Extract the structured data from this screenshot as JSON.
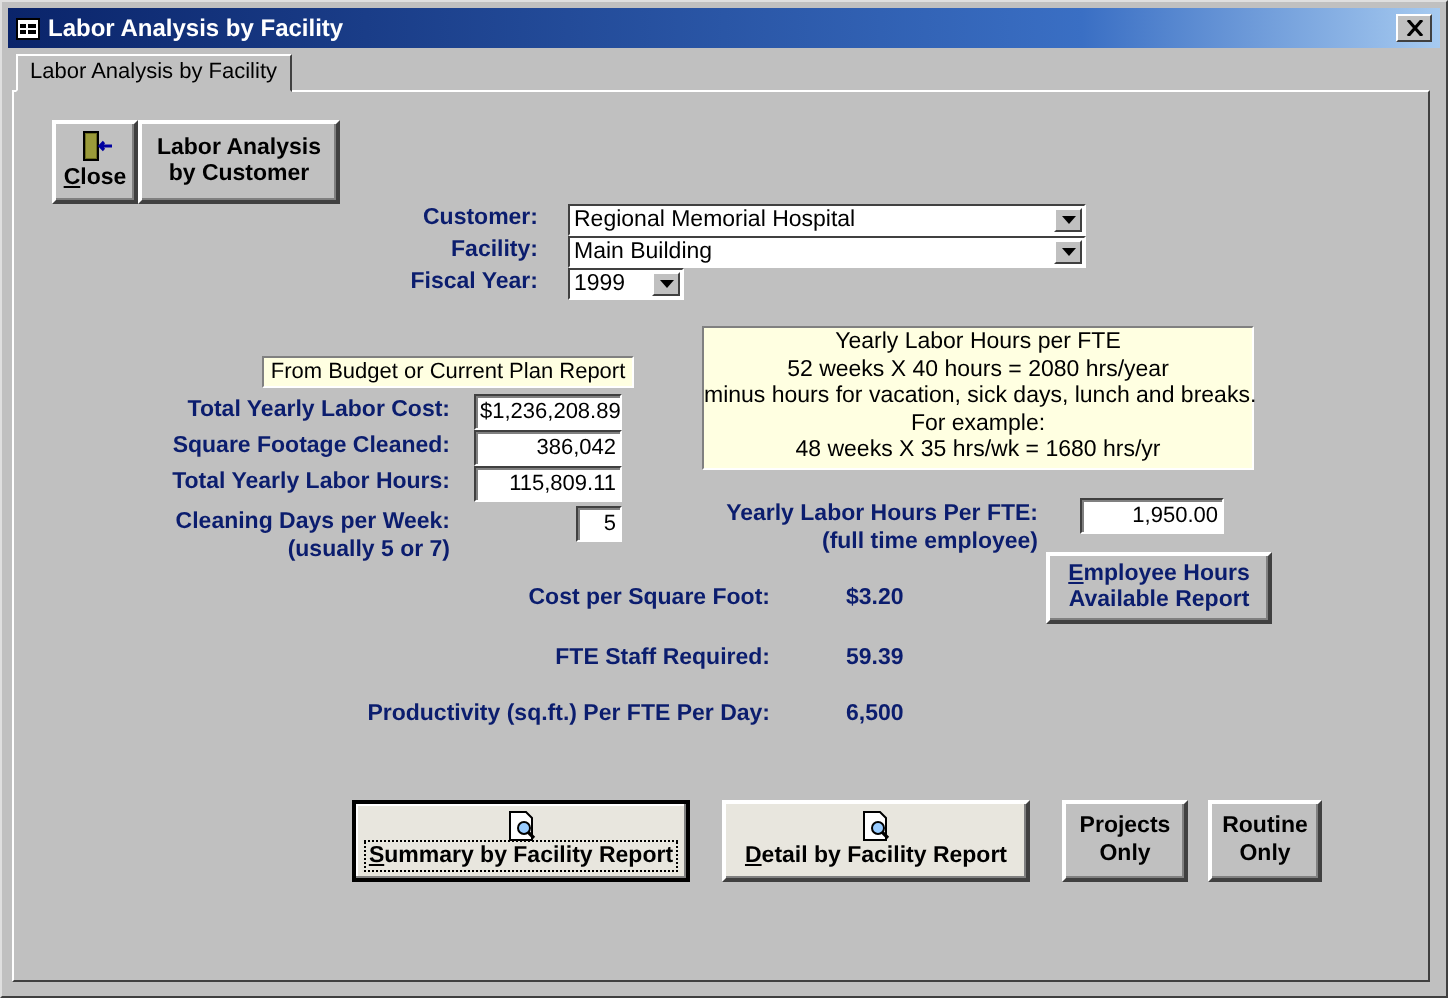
{
  "window": {
    "title": "Labor Analysis by Facility"
  },
  "tabs": [
    {
      "label": "Labor Analysis by Facility",
      "selected": true
    }
  ],
  "top_buttons": [
    {
      "kind": "close",
      "label": "Close",
      "mnemonic": true
    },
    {
      "kind": "text",
      "label": "Labor Analysis\nby Customer",
      "mnemonic": false
    }
  ],
  "selectors": [
    {
      "label": "Customer:",
      "value": "Regional Memorial Hospital"
    },
    {
      "label": "Facility:",
      "value": "Main Building"
    },
    {
      "label": "Fiscal Year:",
      "value": "1999"
    }
  ],
  "source_note": "From Budget or Current Plan Report",
  "inputs": [
    {
      "label": "Total Yearly Labor Cost:",
      "value": "$1,236,208.89"
    },
    {
      "label": "Square Footage Cleaned:",
      "value": "386,042"
    },
    {
      "label": "Total Yearly Labor Hours:",
      "value": "115,809.11"
    },
    {
      "label": "Cleaning Days per Week:",
      "sublabel": "(usually 5 or 7)",
      "value": "5"
    }
  ],
  "info_note": [
    "Yearly Labor Hours per FTE",
    "52 weeks X 40 hours = 2080 hrs/year",
    "minus hours for vacation, sick days, lunch and breaks.",
    "For example:",
    "48 weeks X 35 hrs/wk  = 1680 hrs/yr"
  ],
  "fte_input": {
    "label": "Yearly Labor Hours Per FTE:",
    "sublabel": "(full time employee)",
    "value": "1,950.00"
  },
  "employee_button": {
    "label": "Employee Hours\nAvailable Report",
    "mnemonic": true
  },
  "results": [
    {
      "label": "Cost per Square Foot:",
      "value": "$3.20"
    },
    {
      "label": "FTE Staff Required:",
      "value": "59.39"
    },
    {
      "label": "Productivity (sq.ft.) Per FTE Per Day:",
      "value": "6,500"
    }
  ],
  "bottom_buttons": [
    {
      "kind": "report",
      "label": "Summary by Facility Report",
      "mnemonic": true,
      "focused": true
    },
    {
      "kind": "report",
      "label": "Detail by Facility Report",
      "mnemonic": true,
      "focused": false
    },
    {
      "kind": "text",
      "label": "Projects\nOnly",
      "mnemonic": false,
      "focused": false
    },
    {
      "kind": "text",
      "label": "Routine\nOnly",
      "mnemonic": false,
      "focused": false
    }
  ]
}
